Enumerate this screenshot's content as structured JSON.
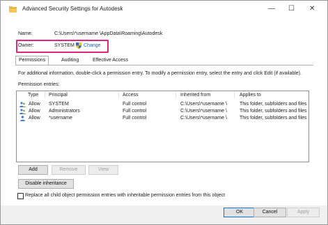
{
  "window": {
    "title": "Advanced Security Settings for Autodesk",
    "minimize": "—",
    "maximize": "☐",
    "close": "✕"
  },
  "info": {
    "name_label": "Name:",
    "name_value": "C:\\Users\\*username \\AppData\\Roaming\\Autodesk",
    "owner_label": "Owner:",
    "owner_value": "SYSTEM",
    "change_link": "Change",
    "highlight_color": "#e0267f"
  },
  "tabs": [
    {
      "label": "Permissions"
    },
    {
      "label": "Auditing"
    },
    {
      "label": "Effective Access"
    }
  ],
  "description": "For additional information, double-click a permission entry. To modify a permission entry, select the entry and click Edit (if available).",
  "entries_label": "Permission entries:",
  "columns": {
    "type": "Type",
    "principal": "Principal",
    "access": "Access",
    "inherited": "Inherited from",
    "applies": "Applies to"
  },
  "rows": [
    {
      "type": "Allow",
      "principal": "SYSTEM",
      "access": "Full control",
      "inherited": "C:\\Users\\*username \\",
      "applies": "This folder, subfolders and files"
    },
    {
      "type": "Allow",
      "principal": "Administrators",
      "access": "Full control",
      "inherited": "C:\\Users\\*username \\",
      "applies": "This folder, subfolders and files"
    },
    {
      "type": "Allow",
      "principal": "*username",
      "access": "Full control",
      "inherited": "C:\\Users\\*username \\",
      "applies": "This folder, subfolders and files"
    }
  ],
  "buttons": {
    "add": "Add",
    "remove": "Remove",
    "view": "View",
    "disable_inheritance": "Disable inheritance",
    "ok": "OK",
    "cancel": "Cancel",
    "apply": "Apply"
  },
  "replace_checkbox": {
    "label": "Replace all child object permission entries with inheritable permission entries from this object",
    "checked": false
  }
}
